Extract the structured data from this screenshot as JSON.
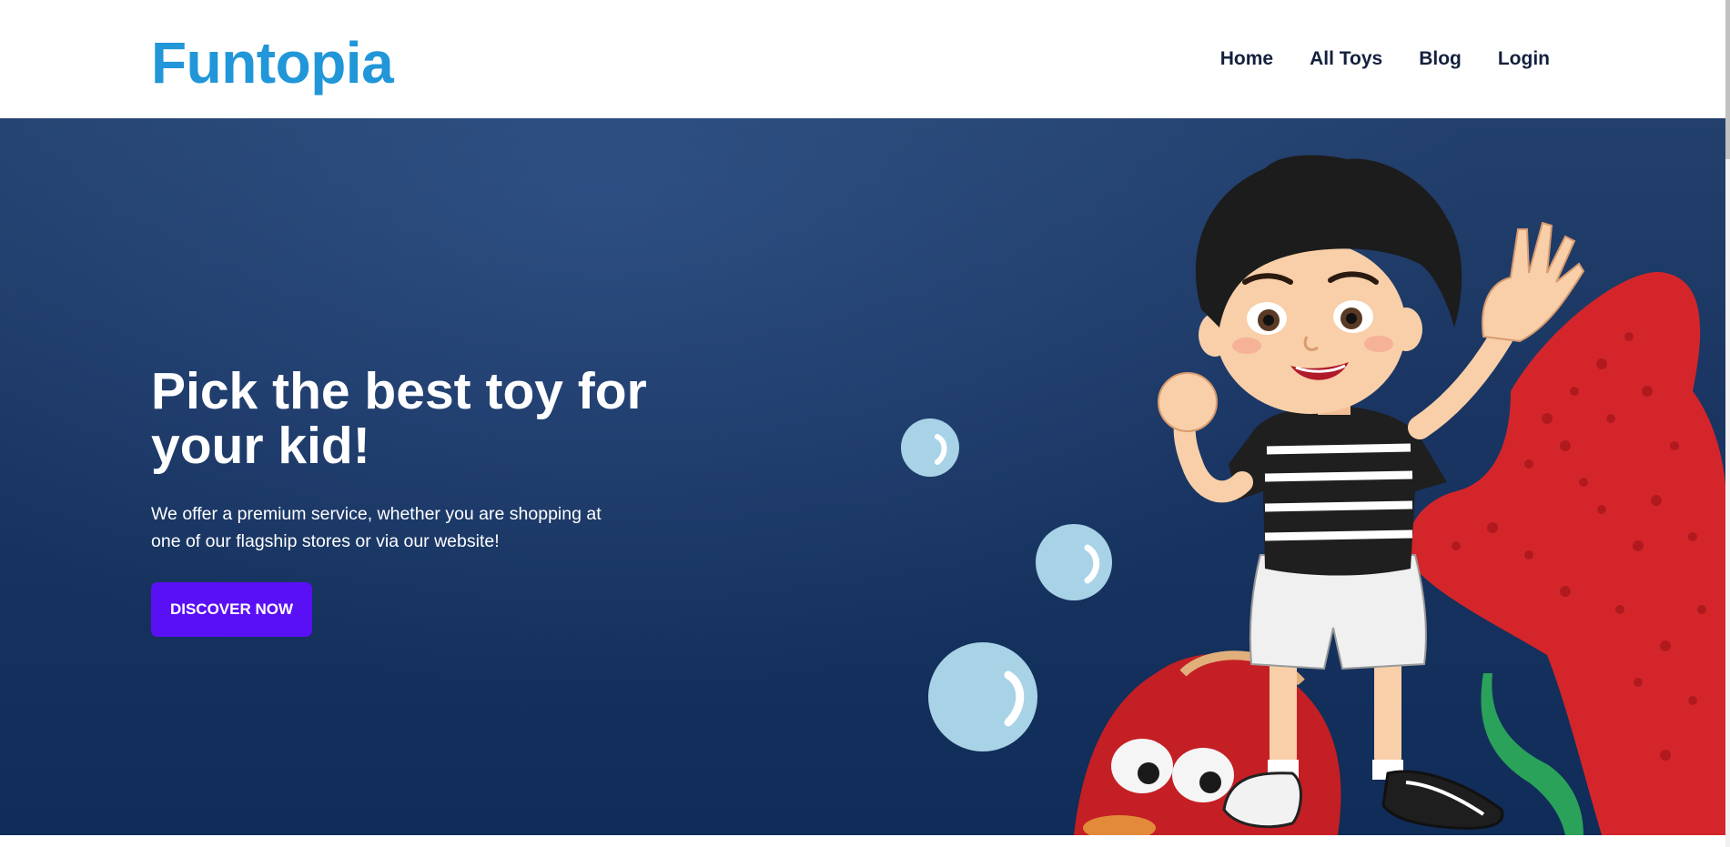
{
  "header": {
    "logo": "Funtopia",
    "nav": [
      {
        "label": "Home"
      },
      {
        "label": "All Toys"
      },
      {
        "label": "Blog"
      },
      {
        "label": "Login"
      }
    ]
  },
  "hero": {
    "title": "Pick the best toy for your kid!",
    "description": "We offer a premium service, whether you are shopping at one of our flagship stores or via our website!",
    "cta_label": "DISCOVER NOW",
    "illustration": "cartoon-boy-waving-with-clay-toys"
  },
  "colors": {
    "brand": "#2196d9",
    "nav_text": "#14213d",
    "hero_background": "#1a3562",
    "cta": "#5a10f5"
  }
}
